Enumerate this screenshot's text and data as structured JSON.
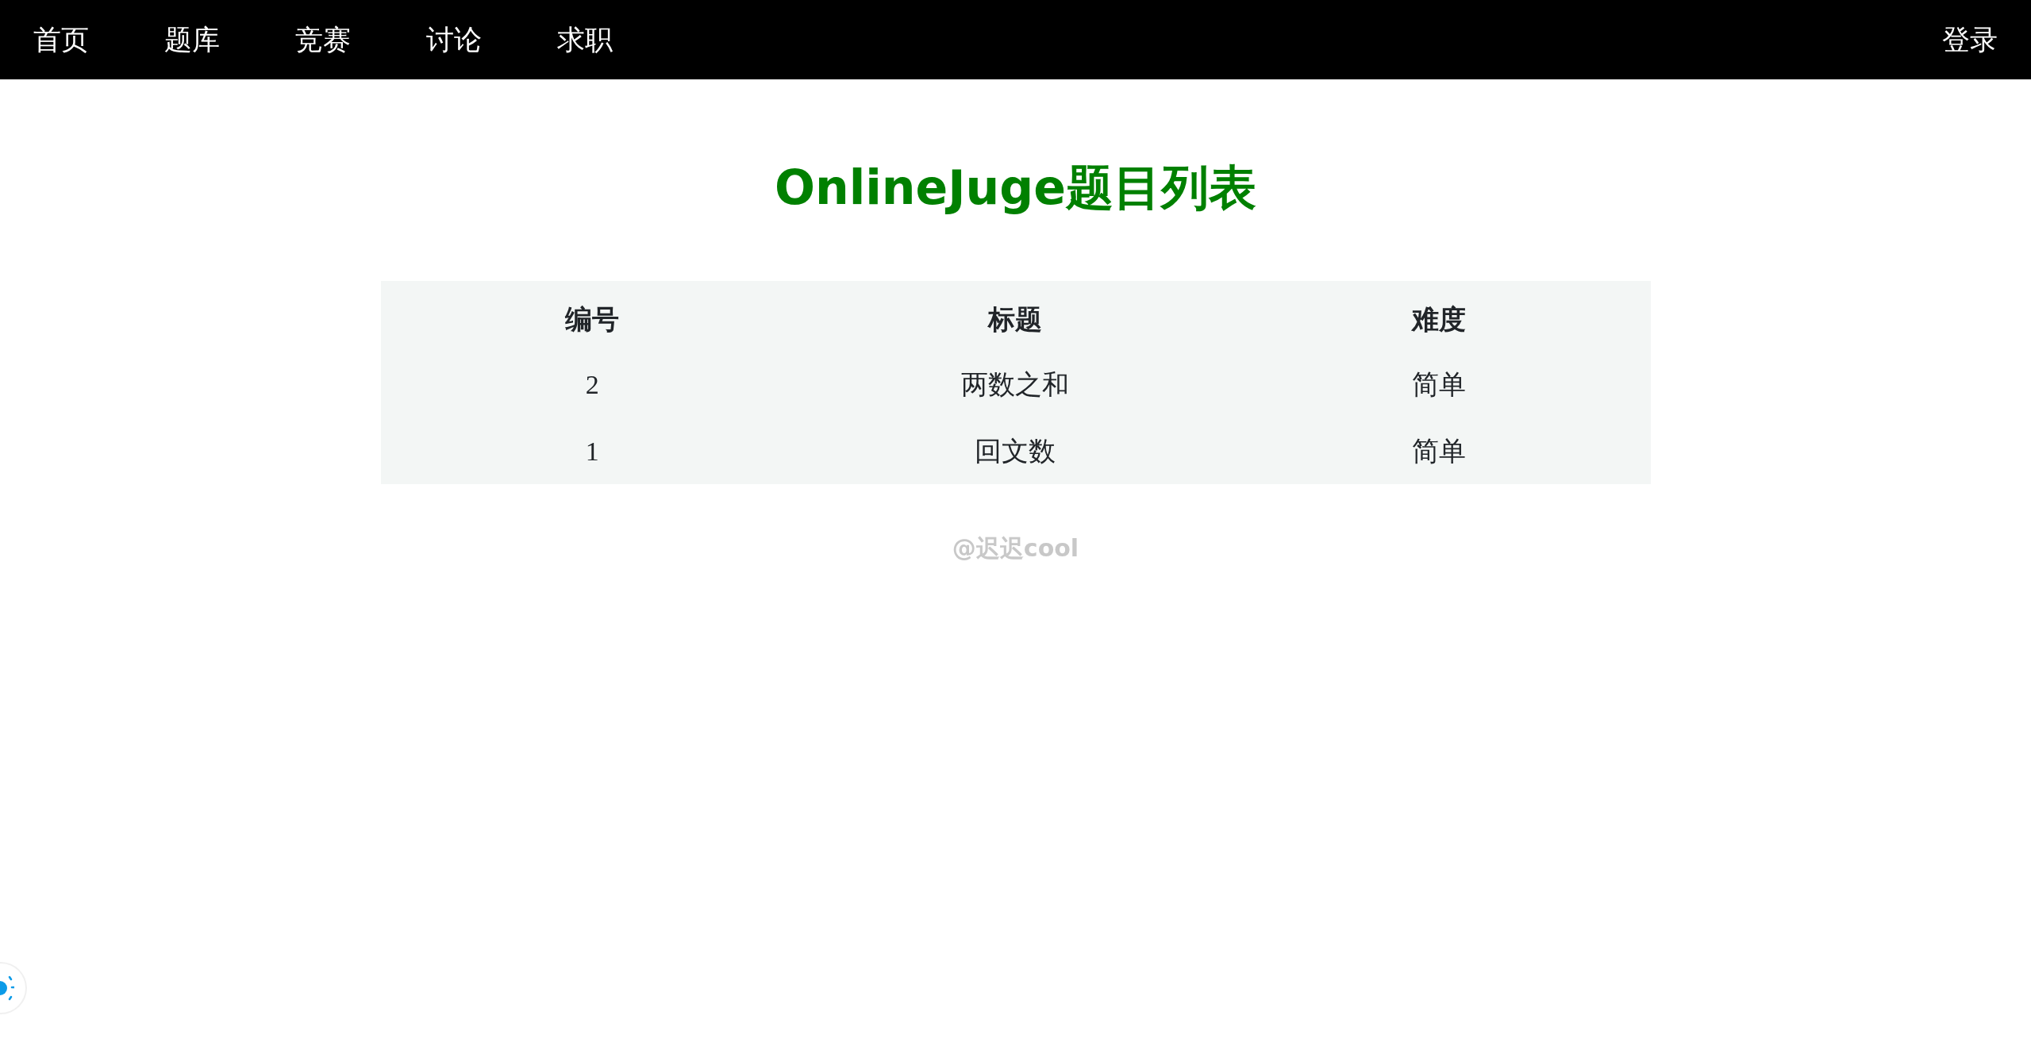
{
  "nav": {
    "items": [
      {
        "label": "首页"
      },
      {
        "label": "题库"
      },
      {
        "label": "竞赛"
      },
      {
        "label": "讨论"
      },
      {
        "label": "求职"
      }
    ],
    "login": "登录"
  },
  "title": "OnlineJuge题目列表",
  "table": {
    "columns": [
      "编号",
      "标题",
      "难度"
    ],
    "rows": [
      [
        "2",
        "两数之和",
        "简单"
      ],
      [
        "1",
        "回文数",
        "简单"
      ]
    ]
  },
  "footer": "@迟迟cool"
}
